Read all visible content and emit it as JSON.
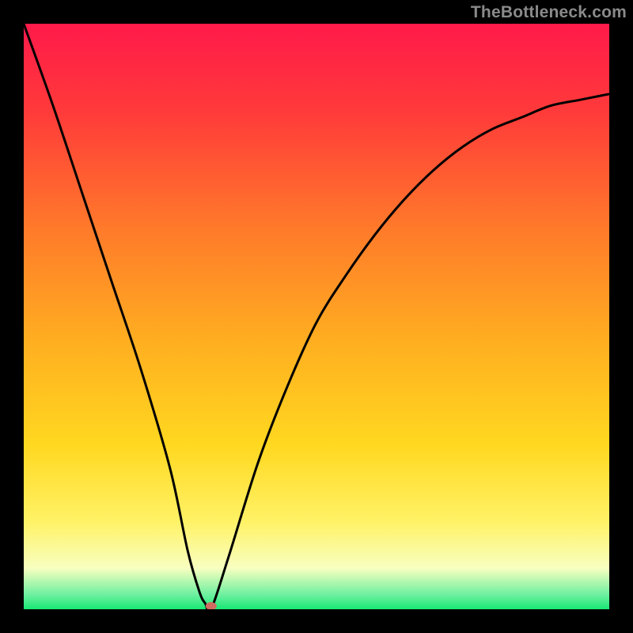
{
  "watermark": {
    "text": "TheBottleneck.com"
  },
  "colors": {
    "frame": "#000000",
    "gradient_stops": [
      {
        "offset": 0.0,
        "color": "#ff1a4a"
      },
      {
        "offset": 0.15,
        "color": "#ff3a3a"
      },
      {
        "offset": 0.35,
        "color": "#ff7a2a"
      },
      {
        "offset": 0.55,
        "color": "#ffb020"
      },
      {
        "offset": 0.72,
        "color": "#ffd820"
      },
      {
        "offset": 0.85,
        "color": "#fff266"
      },
      {
        "offset": 0.93,
        "color": "#f8ffc0"
      },
      {
        "offset": 0.975,
        "color": "#6ef0a0"
      },
      {
        "offset": 1.0,
        "color": "#18e874"
      }
    ],
    "curve": "#000000",
    "dot": "#cf6b60"
  },
  "chart_data": {
    "type": "line",
    "title": "",
    "xlabel": "",
    "ylabel": "",
    "xlim": [
      0,
      100
    ],
    "ylim": [
      0,
      100
    ],
    "annotations": [],
    "series": [
      {
        "name": "bottleneck-curve",
        "x": [
          0,
          5,
          10,
          15,
          20,
          25,
          28,
          30,
          31,
          32,
          35,
          40,
          45,
          50,
          55,
          60,
          65,
          70,
          75,
          80,
          85,
          90,
          95,
          100
        ],
        "y": [
          100,
          86,
          71,
          56,
          41,
          24,
          10,
          3,
          1,
          0,
          9,
          25,
          38,
          49,
          57,
          64,
          70,
          75,
          79,
          82,
          84,
          86,
          87,
          88
        ]
      }
    ],
    "marker": {
      "x": 32,
      "y": 0,
      "name": "minimum-point"
    }
  }
}
